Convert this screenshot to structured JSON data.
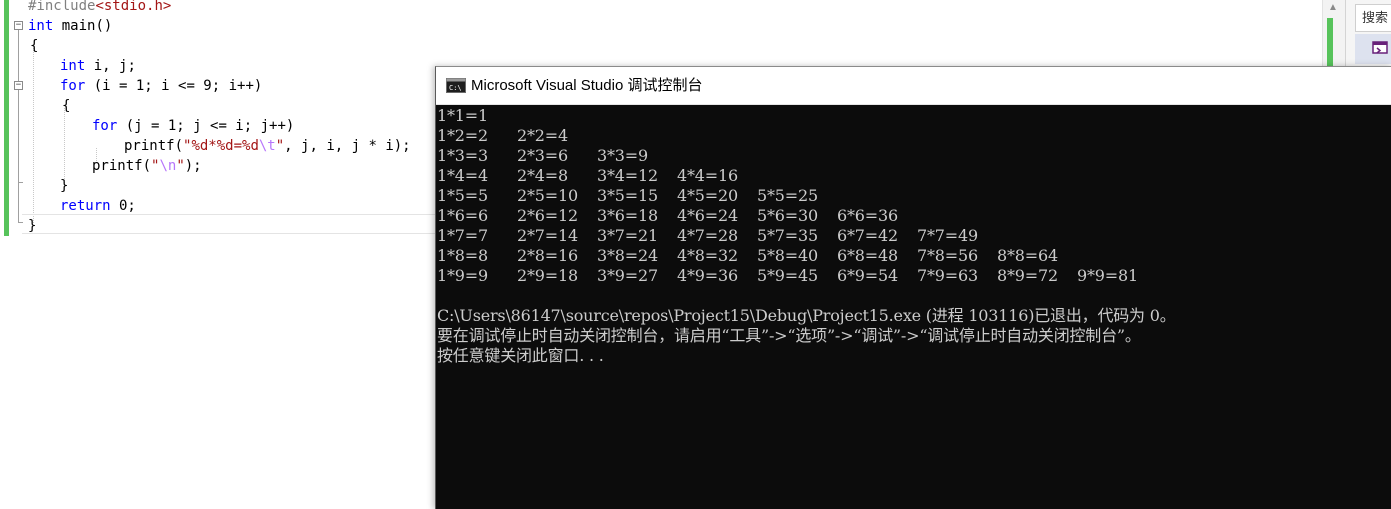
{
  "editor": {
    "lines": {
      "l1_pp": "#include",
      "l1_inc": "<stdio.h>",
      "l2_kw": "int",
      "l2_rest": " main()",
      "l3": "{",
      "l4_kw": "int",
      "l4_rest": " i, j;",
      "l5_kw": "for",
      "l5_rest": " (i = 1; i <= 9; i++)",
      "l6": "{",
      "l7_kw": "for",
      "l7_rest": " (j = 1; j <= i; j++)",
      "l8_fn": "printf(",
      "l8_str1": "\"%d*%d=%d",
      "l8_esc": "\\t",
      "l8_str2": "\"",
      "l8_rest": ", j, i, j * i);",
      "l9_fn": "printf(",
      "l9_str1": "\"",
      "l9_esc": "\\n",
      "l9_str2": "\"",
      "l9_rest": ");",
      "l10": "}",
      "l11_kw": "return",
      "l11_rest": " 0;",
      "l12": "}"
    },
    "fold_glyph": "−"
  },
  "sidebar": {
    "search_label": "搜索",
    "scroll_up_icon": "▲"
  },
  "console": {
    "title": "Microsoft Visual Studio 调试控制台",
    "icon": "console-app-icon",
    "rows": [
      [
        "1*1=1"
      ],
      [
        "1*2=2",
        "2*2=4"
      ],
      [
        "1*3=3",
        "2*3=6",
        "3*3=9"
      ],
      [
        "1*4=4",
        "2*4=8",
        "3*4=12",
        "4*4=16"
      ],
      [
        "1*5=5",
        "2*5=10",
        "3*5=15",
        "4*5=20",
        "5*5=25"
      ],
      [
        "1*6=6",
        "2*6=12",
        "3*6=18",
        "4*6=24",
        "5*6=30",
        "6*6=36"
      ],
      [
        "1*7=7",
        "2*7=14",
        "3*7=21",
        "4*7=28",
        "5*7=35",
        "6*7=42",
        "7*7=49"
      ],
      [
        "1*8=8",
        "2*8=16",
        "3*8=24",
        "4*8=32",
        "5*8=40",
        "6*8=48",
        "7*8=56",
        "8*8=64"
      ],
      [
        "1*9=9",
        "2*9=18",
        "3*9=27",
        "4*9=36",
        "5*9=45",
        "6*9=54",
        "7*9=63",
        "8*9=72",
        "9*9=81"
      ]
    ],
    "exit_message": "C:\\Users\\86147\\source\\repos\\Project15\\Debug\\Project15.exe (进程 103116)已退出，代码为 0。",
    "hint_message": "要在调试停止时自动关闭控制台，请启用“工具”->“选项”->“调试”->“调试停止时自动关闭控制台”。",
    "press_key_message": "按任意键关闭此窗口. . ."
  },
  "colors": {
    "keyword": "#0000ff",
    "string": "#a31515",
    "escape": "#b776fb",
    "preprocessor": "#808080",
    "change_bar": "#57c35b",
    "console_bg": "#0c0c0c",
    "console_fg": "#cccccc"
  }
}
